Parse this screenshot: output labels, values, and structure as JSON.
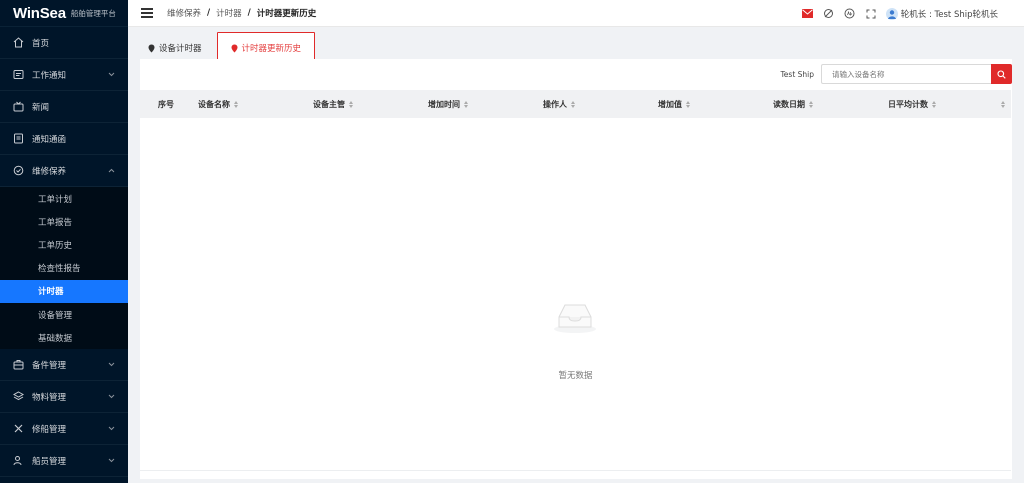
{
  "app": {
    "logo": "WinSea",
    "subtitle": "船舶管理平台"
  },
  "sidebar": {
    "items": [
      {
        "label": "首页",
        "icon": "home-icon"
      },
      {
        "label": "工作通知",
        "icon": "notice-icon",
        "has_children": true
      },
      {
        "label": "新闻",
        "icon": "news-icon"
      },
      {
        "label": "通知通函",
        "icon": "circular-icon"
      },
      {
        "label": "维修保养",
        "icon": "maintenance-icon",
        "expanded": true
      }
    ],
    "subitems": [
      "工单计划",
      "工单报告",
      "工单历史",
      "检查性报告",
      "计时器",
      "设备管理",
      "基础数据"
    ],
    "active_subitem": "计时器",
    "items_after": [
      {
        "label": "备件管理",
        "icon": "spare-parts-icon"
      },
      {
        "label": "物料管理",
        "icon": "materials-icon"
      },
      {
        "label": "修船管理",
        "icon": "ship-repair-icon"
      },
      {
        "label": "船员管理",
        "icon": "crew-icon"
      }
    ]
  },
  "breadcrumb": [
    "维修保养",
    "计时器",
    "计时器更新历史"
  ],
  "header": {
    "user": "轮机长 : Test Ship轮机长"
  },
  "tabs": [
    {
      "label": "设备计时器",
      "active": false
    },
    {
      "label": "计时器更新历史",
      "active": true
    }
  ],
  "filter": {
    "ship_label": "Test Ship",
    "search_placeholder": "请输入设备名称"
  },
  "table": {
    "columns": [
      "序号",
      "设备名称",
      "设备主管",
      "增加时间",
      "操作人",
      "增加值",
      "读数日期",
      "日平均计数"
    ],
    "rows": []
  },
  "empty_text": "暂无数据",
  "colors": {
    "sidebar_bg": "#001529",
    "active_menu": "#1677ff",
    "accent_red": "#e02a2a"
  }
}
